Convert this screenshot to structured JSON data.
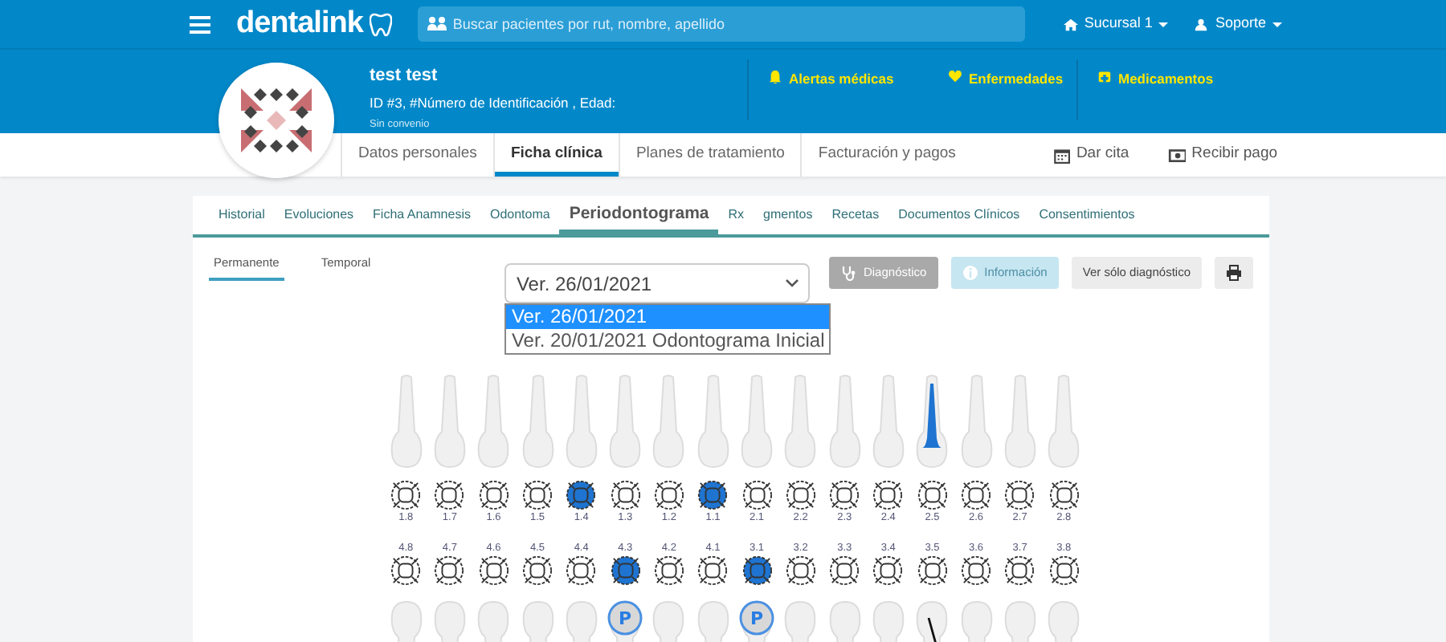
{
  "topbar": {
    "logo": "dentalink",
    "search": {
      "placeholder": "Buscar pacientes por rut, nombre, apellido"
    },
    "menus": [
      {
        "kind": "branch",
        "label": "Sucursal 1"
      },
      {
        "kind": "user",
        "label": "Soporte"
      }
    ]
  },
  "patient": {
    "name": "test test",
    "id_line": "ID #3, #Número de Identificación , Edad:",
    "agreement": "Sin convenio"
  },
  "alerts": [
    {
      "kind": "bell",
      "label": "Alertas médicas"
    },
    {
      "kind": "heart",
      "label": "Enfermedades"
    },
    {
      "kind": "kit",
      "label": "Medicamentos"
    }
  ],
  "nav": {
    "tabs": [
      {
        "label": "Datos personales",
        "selected": false
      },
      {
        "label": "Ficha clínica",
        "selected": true
      },
      {
        "label": "Planes de tratamiento",
        "selected": false
      },
      {
        "label": "Facturación y pagos",
        "selected": false
      }
    ],
    "actions": [
      {
        "kind": "calendar",
        "label": "Dar cita"
      },
      {
        "kind": "money",
        "label": "Recibir pago"
      }
    ]
  },
  "record_tabs": [
    {
      "label": "Historial",
      "selected": false
    },
    {
      "label": "Evoluciones",
      "selected": false
    },
    {
      "label": "Ficha Anamnesis",
      "selected": false
    },
    {
      "label": "Odontoma",
      "selected": false
    },
    {
      "label": "Periodontograma",
      "selected": true
    },
    {
      "label": "Rx",
      "selected": false
    },
    {
      "label": "gmentos",
      "selected": false
    },
    {
      "label": "Recetas",
      "selected": false
    },
    {
      "label": "Documentos Clínicos",
      "selected": false
    },
    {
      "label": "Consentimientos",
      "selected": false
    }
  ],
  "dentition_tabs": [
    {
      "label": "Permanente",
      "selected": true
    },
    {
      "label": "Temporal",
      "selected": false
    }
  ],
  "version_select": {
    "value": "Ver. 26/01/2021",
    "options": [
      {
        "label": "Ver. 26/01/2021",
        "selected": true
      },
      {
        "label": "Ver. 20/01/2021 Odontograma Inicial",
        "selected": false
      }
    ]
  },
  "buttons": [
    {
      "kind": "diagnosis",
      "label": "Diagnóstico",
      "disabled": false
    },
    {
      "kind": "info",
      "label": "Información",
      "disabled": true
    },
    {
      "kind": "plain",
      "label": "Ver sólo diagnóstico",
      "disabled": false
    },
    {
      "kind": "print",
      "disabled": false
    }
  ],
  "upper_teeth": [
    {
      "number": "1.8",
      "marked": false,
      "kind": "normal"
    },
    {
      "number": "1.7",
      "marked": false,
      "kind": "normal"
    },
    {
      "number": "1.6",
      "marked": false,
      "kind": "normal"
    },
    {
      "number": "1.5",
      "marked": false,
      "kind": "normal"
    },
    {
      "number": "1.4",
      "marked": true,
      "kind": "normal"
    },
    {
      "number": "1.3",
      "marked": false,
      "kind": "normal"
    },
    {
      "number": "1.2",
      "marked": false,
      "kind": "normal"
    },
    {
      "number": "1.1",
      "marked": true,
      "kind": "normal"
    },
    {
      "number": "2.1",
      "marked": false,
      "kind": "normal"
    },
    {
      "number": "2.2",
      "marked": false,
      "kind": "normal"
    },
    {
      "number": "2.3",
      "marked": false,
      "kind": "normal"
    },
    {
      "number": "2.4",
      "marked": false,
      "kind": "normal"
    },
    {
      "number": "2.5",
      "marked": false,
      "kind": "root"
    },
    {
      "number": "2.6",
      "marked": false,
      "kind": "normal"
    },
    {
      "number": "2.7",
      "marked": false,
      "kind": "normal"
    },
    {
      "number": "2.8",
      "marked": false,
      "kind": "normal"
    }
  ],
  "lower_teeth": [
    {
      "number": "4.8",
      "marked": false,
      "kind": "normal"
    },
    {
      "number": "4.7",
      "marked": false,
      "kind": "normal"
    },
    {
      "number": "4.6",
      "marked": false,
      "kind": "normal"
    },
    {
      "number": "4.5",
      "marked": false,
      "kind": "normal"
    },
    {
      "number": "4.4",
      "marked": false,
      "kind": "normal"
    },
    {
      "number": "4.3",
      "marked": true,
      "kind": "prosthesis",
      "badge": "P"
    },
    {
      "number": "4.2",
      "marked": false,
      "kind": "normal"
    },
    {
      "number": "4.1",
      "marked": false,
      "kind": "normal"
    },
    {
      "number": "3.1",
      "marked": true,
      "kind": "prosthesis",
      "badge": "P"
    },
    {
      "number": "3.2",
      "marked": false,
      "kind": "normal"
    },
    {
      "number": "3.3",
      "marked": false,
      "kind": "normal"
    },
    {
      "number": "3.4",
      "marked": false,
      "kind": "normal"
    },
    {
      "number": "3.5",
      "marked": false,
      "kind": "fracture"
    },
    {
      "number": "3.6",
      "marked": false,
      "kind": "normal"
    },
    {
      "number": "3.7",
      "marked": false,
      "kind": "normal"
    },
    {
      "number": "3.8",
      "marked": false,
      "kind": "normal"
    }
  ]
}
